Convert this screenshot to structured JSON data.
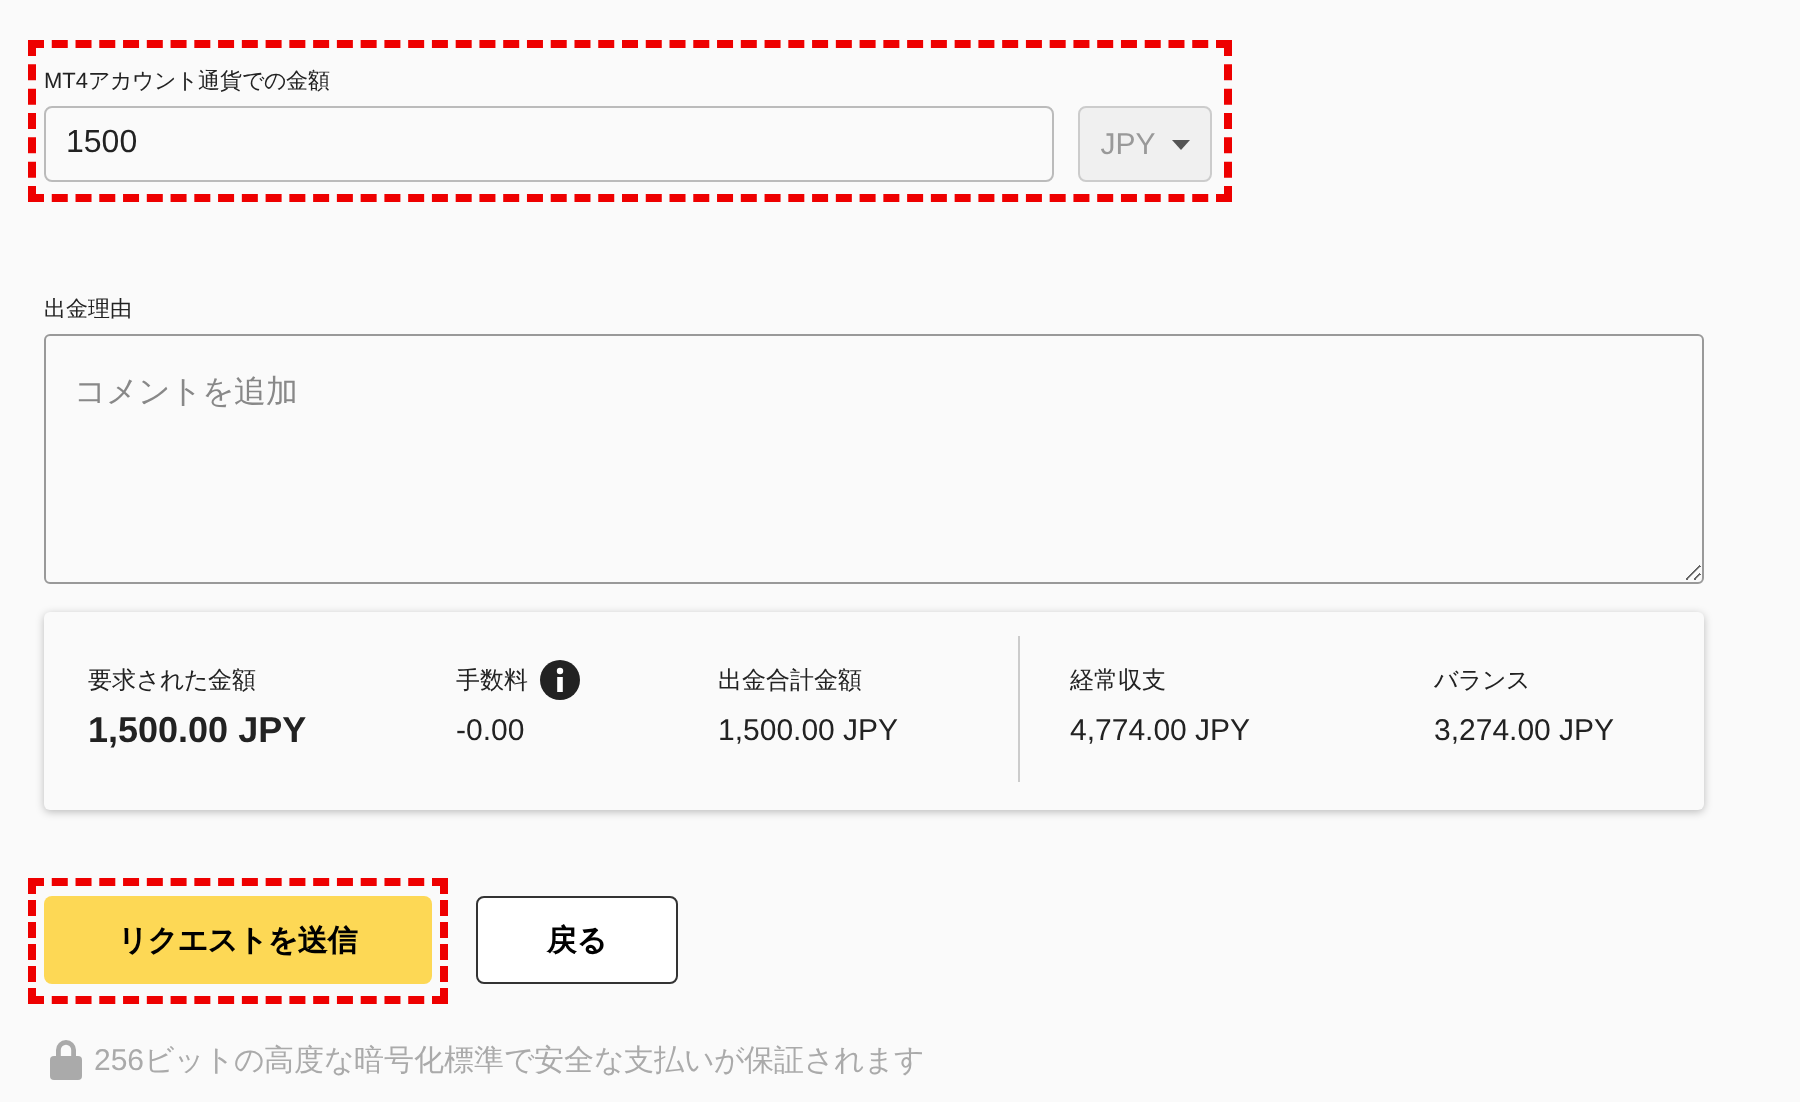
{
  "amount_field": {
    "label": "MT4アカウント通貨での金額",
    "value": "1500",
    "highlighted": true,
    "currency": {
      "value": "JPY",
      "disabled": true
    }
  },
  "reason_field": {
    "label": "出金理由",
    "placeholder": "コメントを追加"
  },
  "summary": {
    "groups": [
      [
        {
          "label": "要求された金額",
          "value": "1,500.00 JPY",
          "kind": "primary",
          "info": false
        },
        {
          "label": "手数料",
          "value": "-0.00",
          "kind": "plain",
          "info": true
        },
        {
          "label": "出金合計金額",
          "value": "1,500.00 JPY",
          "kind": "plain",
          "info": false
        }
      ],
      [
        {
          "label": "経常収支",
          "value": "4,774.00 JPY",
          "kind": "plain",
          "info": false
        },
        {
          "label": "バランス",
          "value": "3,274.00 JPY",
          "kind": "plain",
          "info": false
        }
      ]
    ]
  },
  "buttons": [
    {
      "label": "リクエストを送信",
      "kind": "primary",
      "highlighted": true
    },
    {
      "label": "戻る",
      "kind": "secondary",
      "highlighted": false
    }
  ],
  "security_note": "256ビットの高度な暗号化標準で安全な支払いが保証されます"
}
